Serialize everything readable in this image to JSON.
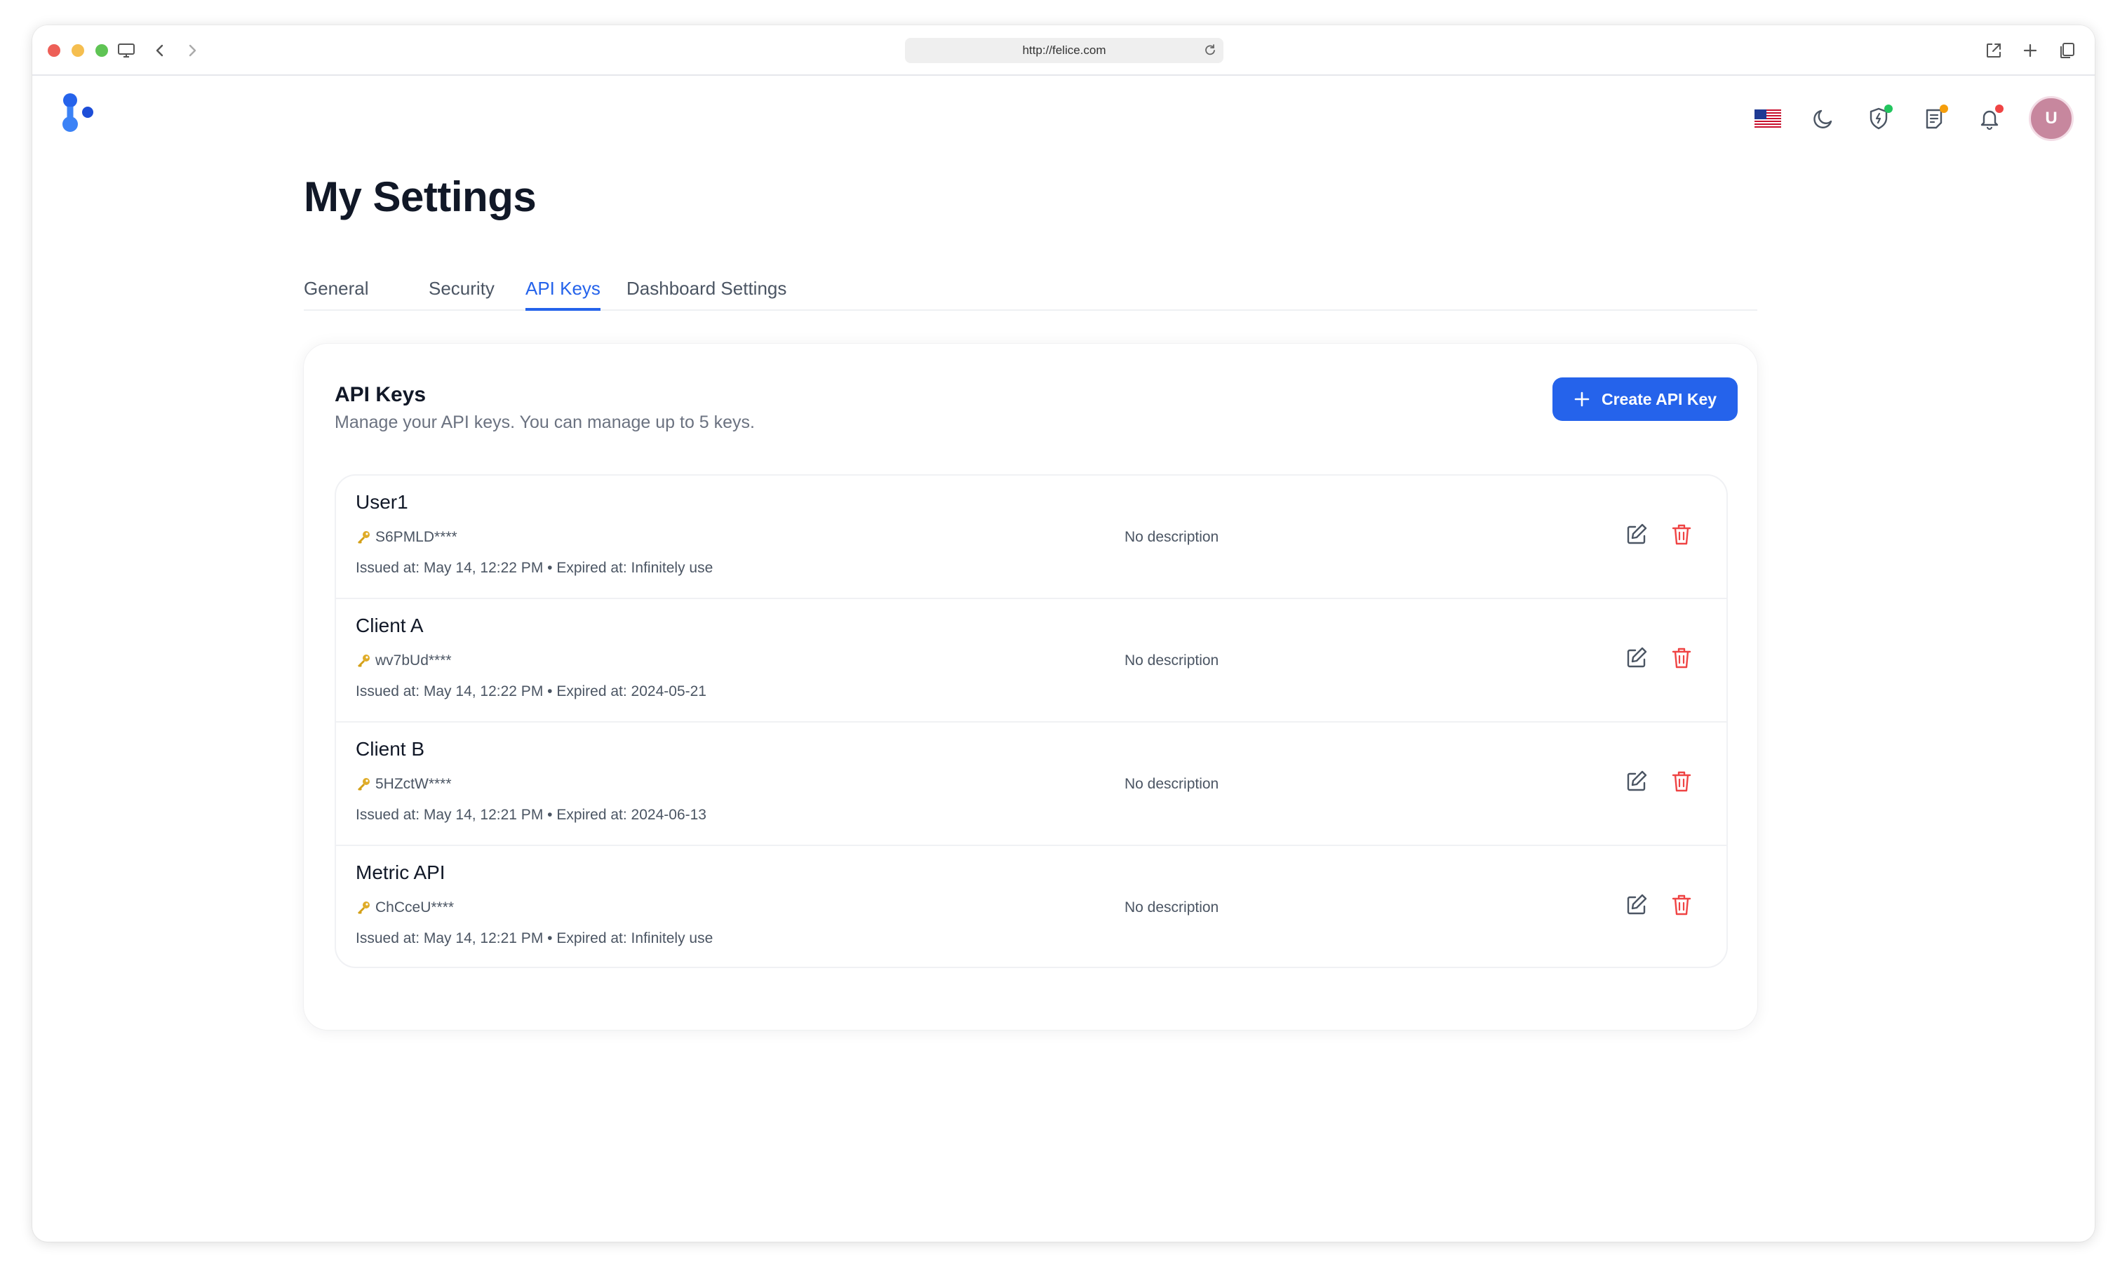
{
  "browser": {
    "url": "http://felice.com"
  },
  "header": {
    "avatar_initial": "U",
    "notification_dots": {
      "security": "#22c55e",
      "notes": "#f59e0b",
      "bell": "#ef4444"
    }
  },
  "page": {
    "title": "My Settings",
    "tabs": [
      {
        "label": "General",
        "active": false
      },
      {
        "label": "Security",
        "active": false
      },
      {
        "label": "API Keys",
        "active": true
      },
      {
        "label": "Dashboard Settings",
        "active": false
      }
    ]
  },
  "api_keys": {
    "title": "API Keys",
    "subtitle": "Manage your API keys. You can manage up to 5 keys.",
    "create_label": "Create API Key",
    "items": [
      {
        "name": "User1",
        "token": "S6PMLD****",
        "description": "No description",
        "meta": "Issued at: May 14, 12:22 PM • Expired at: Infinitely use"
      },
      {
        "name": "Client A",
        "token": "wv7bUd****",
        "description": "No description",
        "meta": "Issued at: May 14, 12:22 PM • Expired at: 2024-05-21"
      },
      {
        "name": "Client B",
        "token": "5HZctW****",
        "description": "No description",
        "meta": "Issued at: May 14, 12:21 PM • Expired at: 2024-06-13"
      },
      {
        "name": "Metric API",
        "token": "ChCceU****",
        "description": "No description",
        "meta": "Issued at: May 14, 12:21 PM • Expired at: Infinitely use"
      }
    ]
  },
  "colors": {
    "accent": "#2563eb",
    "danger": "#ef4444",
    "key_icon": "#d4a017",
    "avatar": "#c7879e"
  }
}
